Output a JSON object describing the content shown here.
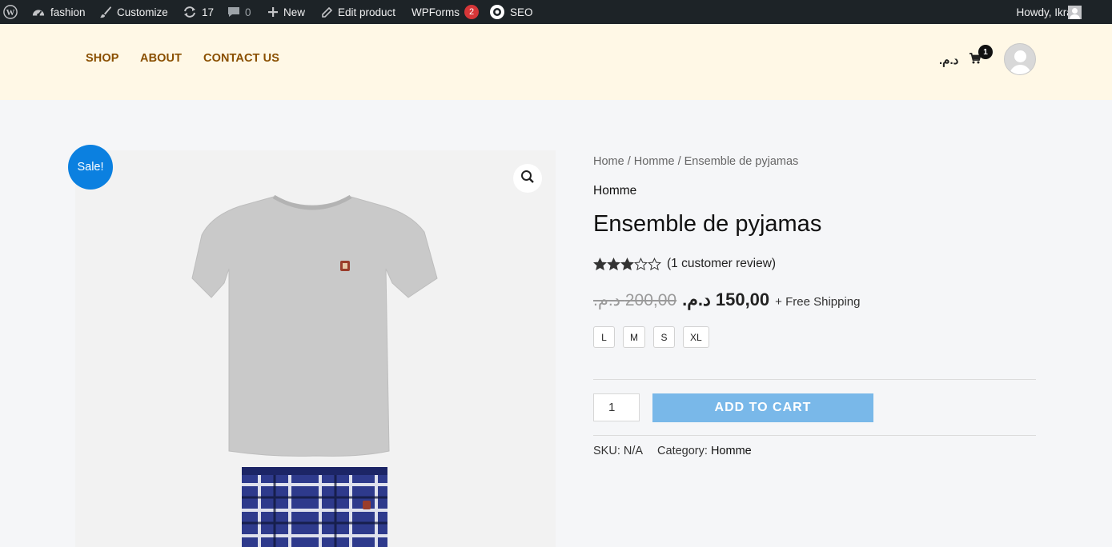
{
  "admin_bar": {
    "site_name": "fashion",
    "customize": "Customize",
    "updates_count": "17",
    "comments_count": "0",
    "new_label": "New",
    "edit_product": "Edit product",
    "wpforms_label": "WPForms",
    "wpforms_badge": "2",
    "seo_label": "SEO",
    "greeting": "Howdy, Ikram"
  },
  "nav": {
    "shop": "SHOP",
    "about": "ABOUT",
    "contact": "CONTACT US"
  },
  "header": {
    "currency": "د.م.",
    "cart_count": "1"
  },
  "gallery": {
    "sale_badge": "Sale!"
  },
  "product": {
    "breadcrumb": {
      "home": "Home",
      "category": "Homme",
      "current": "Ensemble de pyjamas",
      "separator": "/"
    },
    "category_label": "Homme",
    "title": "Ensemble de pyjamas",
    "rating": 3,
    "rating_max": 5,
    "review_text": "(1 customer review)",
    "price_old": "200,00 د.م.",
    "price_new": "150,00 د.م.",
    "shipping": "+ Free Shipping",
    "sizes": [
      "L",
      "M",
      "S",
      "XL"
    ],
    "quantity": "1",
    "add_to_cart": "ADD TO CART",
    "sku_label": "SKU:",
    "sku_value": "N/A",
    "category_meta_label": "Category:",
    "category_meta_value": "Homme"
  },
  "colors": {
    "admin_bar": "#1d2327",
    "header_bg": "#fff8e6",
    "nav_link": "#8a4f00",
    "sale_badge": "#0b80e0",
    "add_to_cart": "#79b8e9",
    "badge_red": "#d63638"
  }
}
